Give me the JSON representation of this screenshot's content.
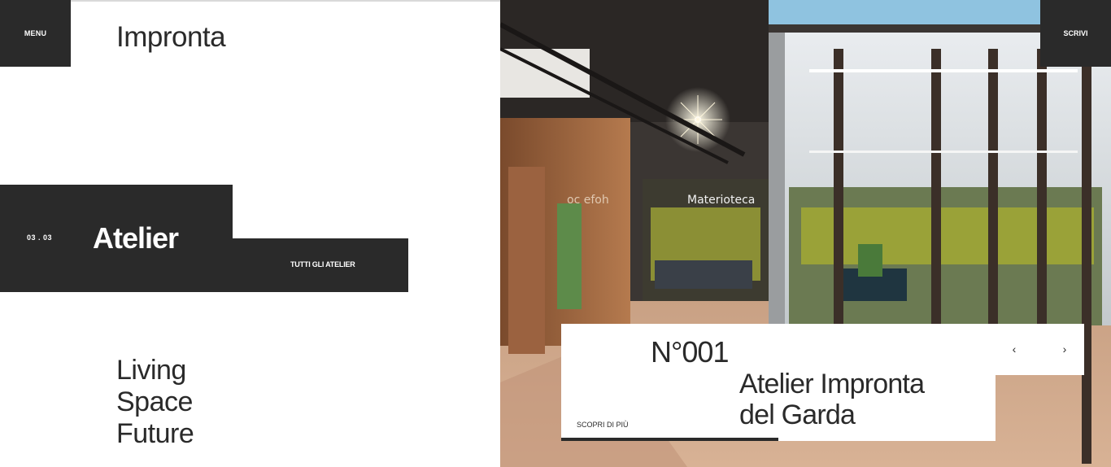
{
  "header": {
    "menu_label": "MENU",
    "brand": "Impronta",
    "write_label": "SCRIVI"
  },
  "section": {
    "counter": "03 . 03",
    "title": "Atelier",
    "all_link": "TUTTI GLI ATELIER"
  },
  "tagline": {
    "lines": [
      "Living",
      "Space",
      "Future"
    ]
  },
  "slide": {
    "number": "N°001",
    "title_lines": [
      "Atelier Impronta",
      "del Garda"
    ],
    "cta": "SCOPRI DI PIÙ",
    "progress": 0.5,
    "prev_icon": "chevron-left-icon",
    "next_icon": "chevron-right-icon"
  },
  "colors": {
    "dark": "#2a2a2a",
    "background": "#ffffff"
  }
}
